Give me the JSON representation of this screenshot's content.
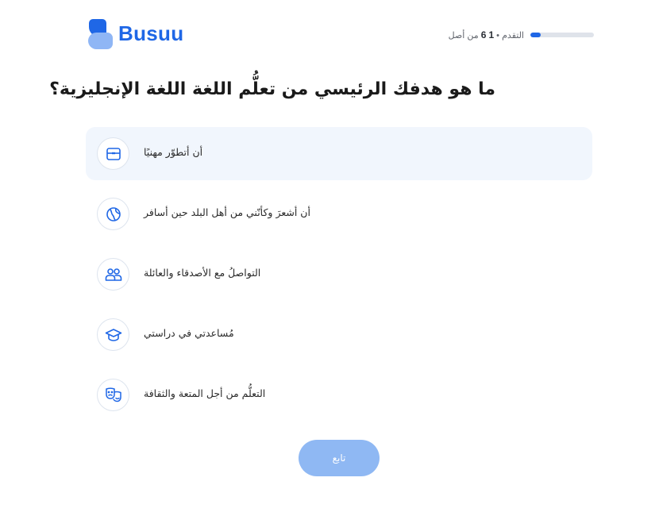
{
  "app": {
    "name": "Busuu"
  },
  "progress": {
    "label": "التقدم",
    "current": "1",
    "total": "6",
    "of_text": "من أصل",
    "fraction": 0.1667
  },
  "question": "ما هو هدفك الرئيسي من تعلُّم اللغة اللغة الإنجليزية؟",
  "options": [
    {
      "label": "أن أتطوّر مهنيًا",
      "icon": "briefcase-icon",
      "selected": true
    },
    {
      "label": "أن أشعرَ وكأنّني من أهل البلد حين أسافر",
      "icon": "globe-icon",
      "selected": false
    },
    {
      "label": "التواصلُ مع الأصدقاء والعائلة",
      "icon": "people-icon",
      "selected": false
    },
    {
      "label": "مُساعدتي في دراستي",
      "icon": "graduation-cap-icon",
      "selected": false
    },
    {
      "label": "التعلُّم من أجل المتعة والثقافة",
      "icon": "theater-masks-icon",
      "selected": false
    }
  ],
  "continue_label": "تابع",
  "colors": {
    "brand": "#1f67e6",
    "brand_light": "#8fb6f5",
    "selected_bg": "#f1f6fd",
    "button_disabled": "#8fb8f3"
  }
}
